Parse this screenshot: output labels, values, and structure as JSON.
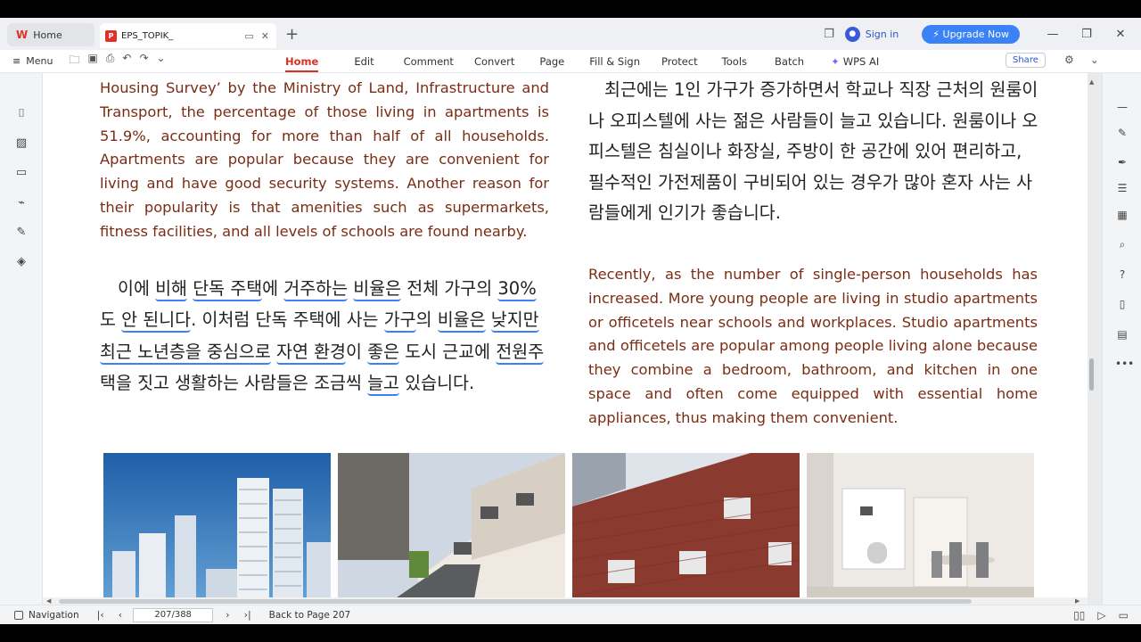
{
  "tabs": {
    "home_label": "Home",
    "doc_label": "EPS_TOPIK_",
    "new_tab": "+"
  },
  "account": {
    "signin_label": "Sign in",
    "upgrade_label": "Upgrade Now"
  },
  "ribbon": {
    "menu_label": "Menu",
    "tabs": [
      {
        "label": "Home",
        "active": true
      },
      {
        "label": "Edit"
      },
      {
        "label": "Comment"
      },
      {
        "label": "Convert"
      },
      {
        "label": "Page"
      },
      {
        "label": "Fill & Sign"
      },
      {
        "label": "Protect"
      },
      {
        "label": "Tools"
      },
      {
        "label": "Batch"
      },
      {
        "label": "WPS AI"
      }
    ],
    "share_label": "Share"
  },
  "document": {
    "left_en": "Housing Survey’ by the Ministry of Land, Infrastructure and Transport, the percentage of those living in apartments is 51.9%, accounting for more than half of all households. Apartments are popular because they are convenient for living and have good security systems. Another reason for their popularity is that amenities such as supermarkets, fitness facilities, and all levels of schools are found nearby.",
    "left_ko": {
      "s1": "이에 ",
      "u1": "비해",
      "s2": " ",
      "u2": "단독 주택",
      "s3": "에 ",
      "u3": "거주하는",
      "s4": " ",
      "u4": "비율은",
      "s5": " 전체 가구의 ",
      "u5": "30%",
      "s6": "도 ",
      "u6": "안 된니다",
      "s7": ". 이처럼 단독 주택에 사는 ",
      "u7": "가구",
      "s8": "의 ",
      "u8": "비율은",
      "s9": " ",
      "u9": "낮지만",
      "u10": "최근 노년층을 중심으로",
      "s10": " ",
      "u11": "자연 환경",
      "s11": "이 ",
      "u12": "좋은",
      "s12": " 도시 근교에 ",
      "u13": "전원주",
      "s13": "택을 짓고 생활하는 사람들은 조금씩 ",
      "u14": "늘고",
      "s14": " 있습니다."
    },
    "right_ko": "최근에는 1인 가구가 증가하면서 학교나 직장 근처의 원룸이나 오피스텔에 사는 젊은 사람들이 늘고 있습니다. 원룸이나 오피스텔은 침실이나 화장실, 주방이 한 공간에 있어 편리하고, 필수적인 가전제품이 구비되어 있는 경우가 많아 혼자 사는 사람들에게 인기가 좋습니다.",
    "right_en": "Recently, as the number of single-person households has increased. More young people are living in studio apartments or officetels near schools and workplaces. Studio apartments and officetels are popular among people living alone because they combine a bedroom, bathroom, and kitchen in one space and often come equipped with essential home appliances, thus making them convenient."
  },
  "status": {
    "navigation_label": "Navigation",
    "page_value": "207/388",
    "back_label": "Back to Page 207"
  },
  "colors": {
    "accent": "#d93025",
    "english_text": "#7b2d14",
    "underline": "#3b82f6",
    "upgrade": "#3b82f6"
  }
}
